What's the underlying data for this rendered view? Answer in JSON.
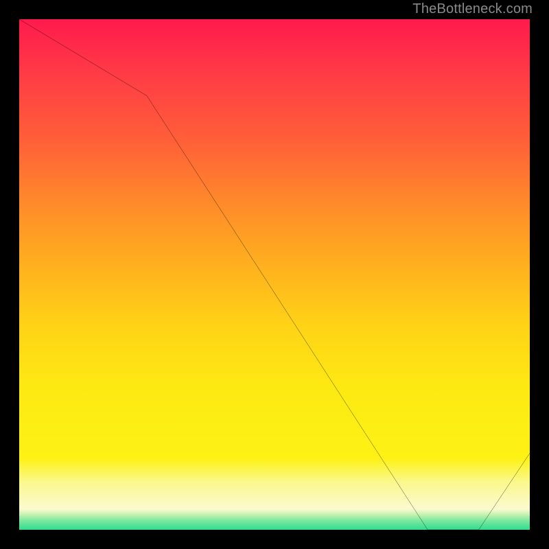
{
  "attribution": "TheBottleneck.com",
  "chart_data": {
    "type": "line",
    "title": "",
    "xlabel": "",
    "ylabel": "",
    "xlim": [
      0,
      100
    ],
    "ylim": [
      0,
      100
    ],
    "x": [
      0,
      25,
      80,
      90,
      100
    ],
    "y": [
      100,
      85,
      0,
      0,
      15
    ],
    "marker": {
      "x_range": [
        76,
        90
      ],
      "y": 0,
      "label": ""
    }
  },
  "colors": {
    "line": "#000000",
    "bg_black": "#000000",
    "grad_red": "#ff1a4d",
    "grad_yellow": "#fdf214",
    "grad_green": "#2fdc90",
    "marker_text": "#d23c1c"
  }
}
